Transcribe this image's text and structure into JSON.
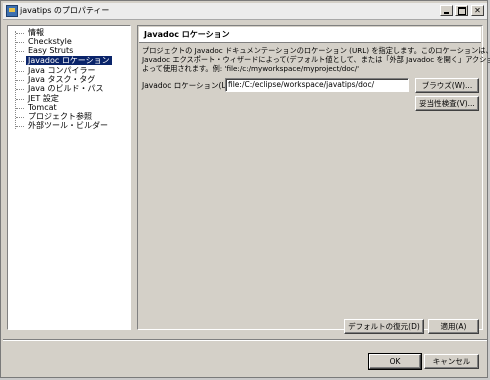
{
  "window": {
    "title": "javatips のプロパティー"
  },
  "tree": {
    "items": [
      {
        "label": "情報"
      },
      {
        "label": "Checkstyle"
      },
      {
        "label": "Easy Struts"
      },
      {
        "label": "Javadoc ロケーション",
        "selected": true
      },
      {
        "label": "Java コンパイラー"
      },
      {
        "label": "Java タスク・タグ"
      },
      {
        "label": "Java のビルド・パス"
      },
      {
        "label": "JET 設定"
      },
      {
        "label": "Tomcat"
      },
      {
        "label": "プロジェクト参照"
      },
      {
        "label": "外部ツール・ビルダー"
      }
    ]
  },
  "panel": {
    "title": "Javadoc ロケーション",
    "description": [
      "プロジェクトの Javadoc ドキュメンテーションのロケーション (URL) を指定します。このロケーションは、",
      "Javadoc エクスポート・ウィザードによって(デフォルト値として、または「外部 Javadoc を開く」アクションに",
      "よって使用されます。例: 'file:/c:/myworkspace/myproject/doc/'"
    ],
    "location_label": "Javadoc ロケーション(L):",
    "location_value": "file:/C:/eclipse/workspace/javatips/doc/",
    "browse_label": "ブラウズ(W)...",
    "validate_label": "妥当性検査(V)...",
    "restore_defaults_label": "デフォルトの復元(D)",
    "apply_label": "適用(A)"
  },
  "footer": {
    "ok_label": "OK",
    "cancel_label": "キャンセル"
  }
}
